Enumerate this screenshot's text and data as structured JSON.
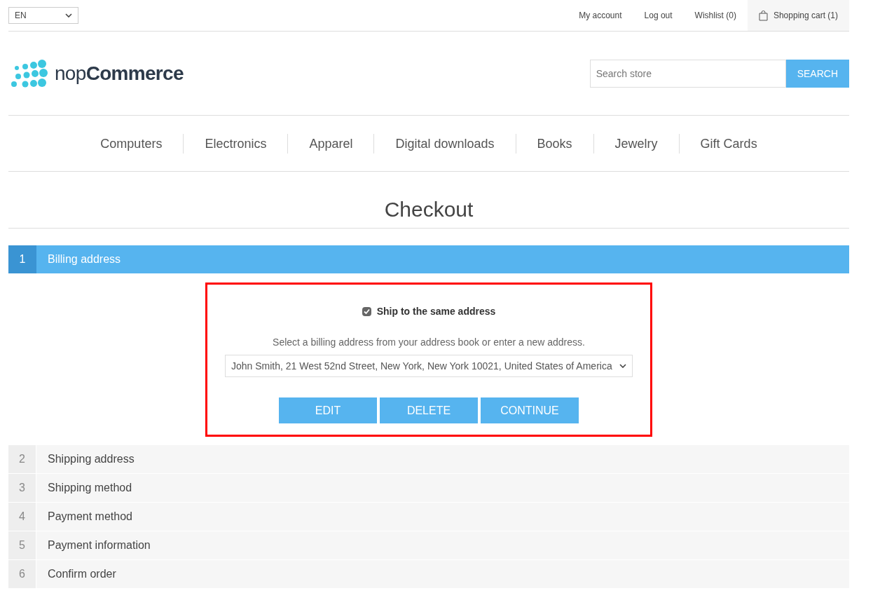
{
  "header": {
    "language": "EN",
    "links": [
      "My account",
      "Log out",
      "Wishlist (0)"
    ],
    "cart": "Shopping cart (1)"
  },
  "logo": "nop**Commerce**",
  "search": {
    "placeholder": "Search store",
    "button": "SEARCH"
  },
  "menu": [
    "Computers",
    "Electronics",
    "Apparel",
    "Digital downloads",
    "Books",
    "Jewelry",
    "Gift Cards"
  ],
  "page_title": "Checkout",
  "steps": [
    {
      "number": "1",
      "label": "Billing address",
      "selected": true
    },
    {
      "number": "2",
      "label": "Shipping address",
      "selected": false
    },
    {
      "number": "3",
      "label": "Shipping method",
      "selected": false
    },
    {
      "number": "4",
      "label": "Payment method",
      "selected": false
    },
    {
      "number": "5",
      "label": "Payment information",
      "selected": false
    },
    {
      "number": "6",
      "label": "Confirm order",
      "selected": false
    }
  ],
  "billing": {
    "ship_same": {
      "label": "Ship to the same address",
      "checked": true
    },
    "hint": "Select a billing address from your address book or enter a new address.",
    "address": "John Smith, 21 West 52nd Street, New York, New York 10021, United States of America",
    "buttons": [
      "EDIT",
      "DELETE",
      "CONTINUE"
    ]
  }
}
